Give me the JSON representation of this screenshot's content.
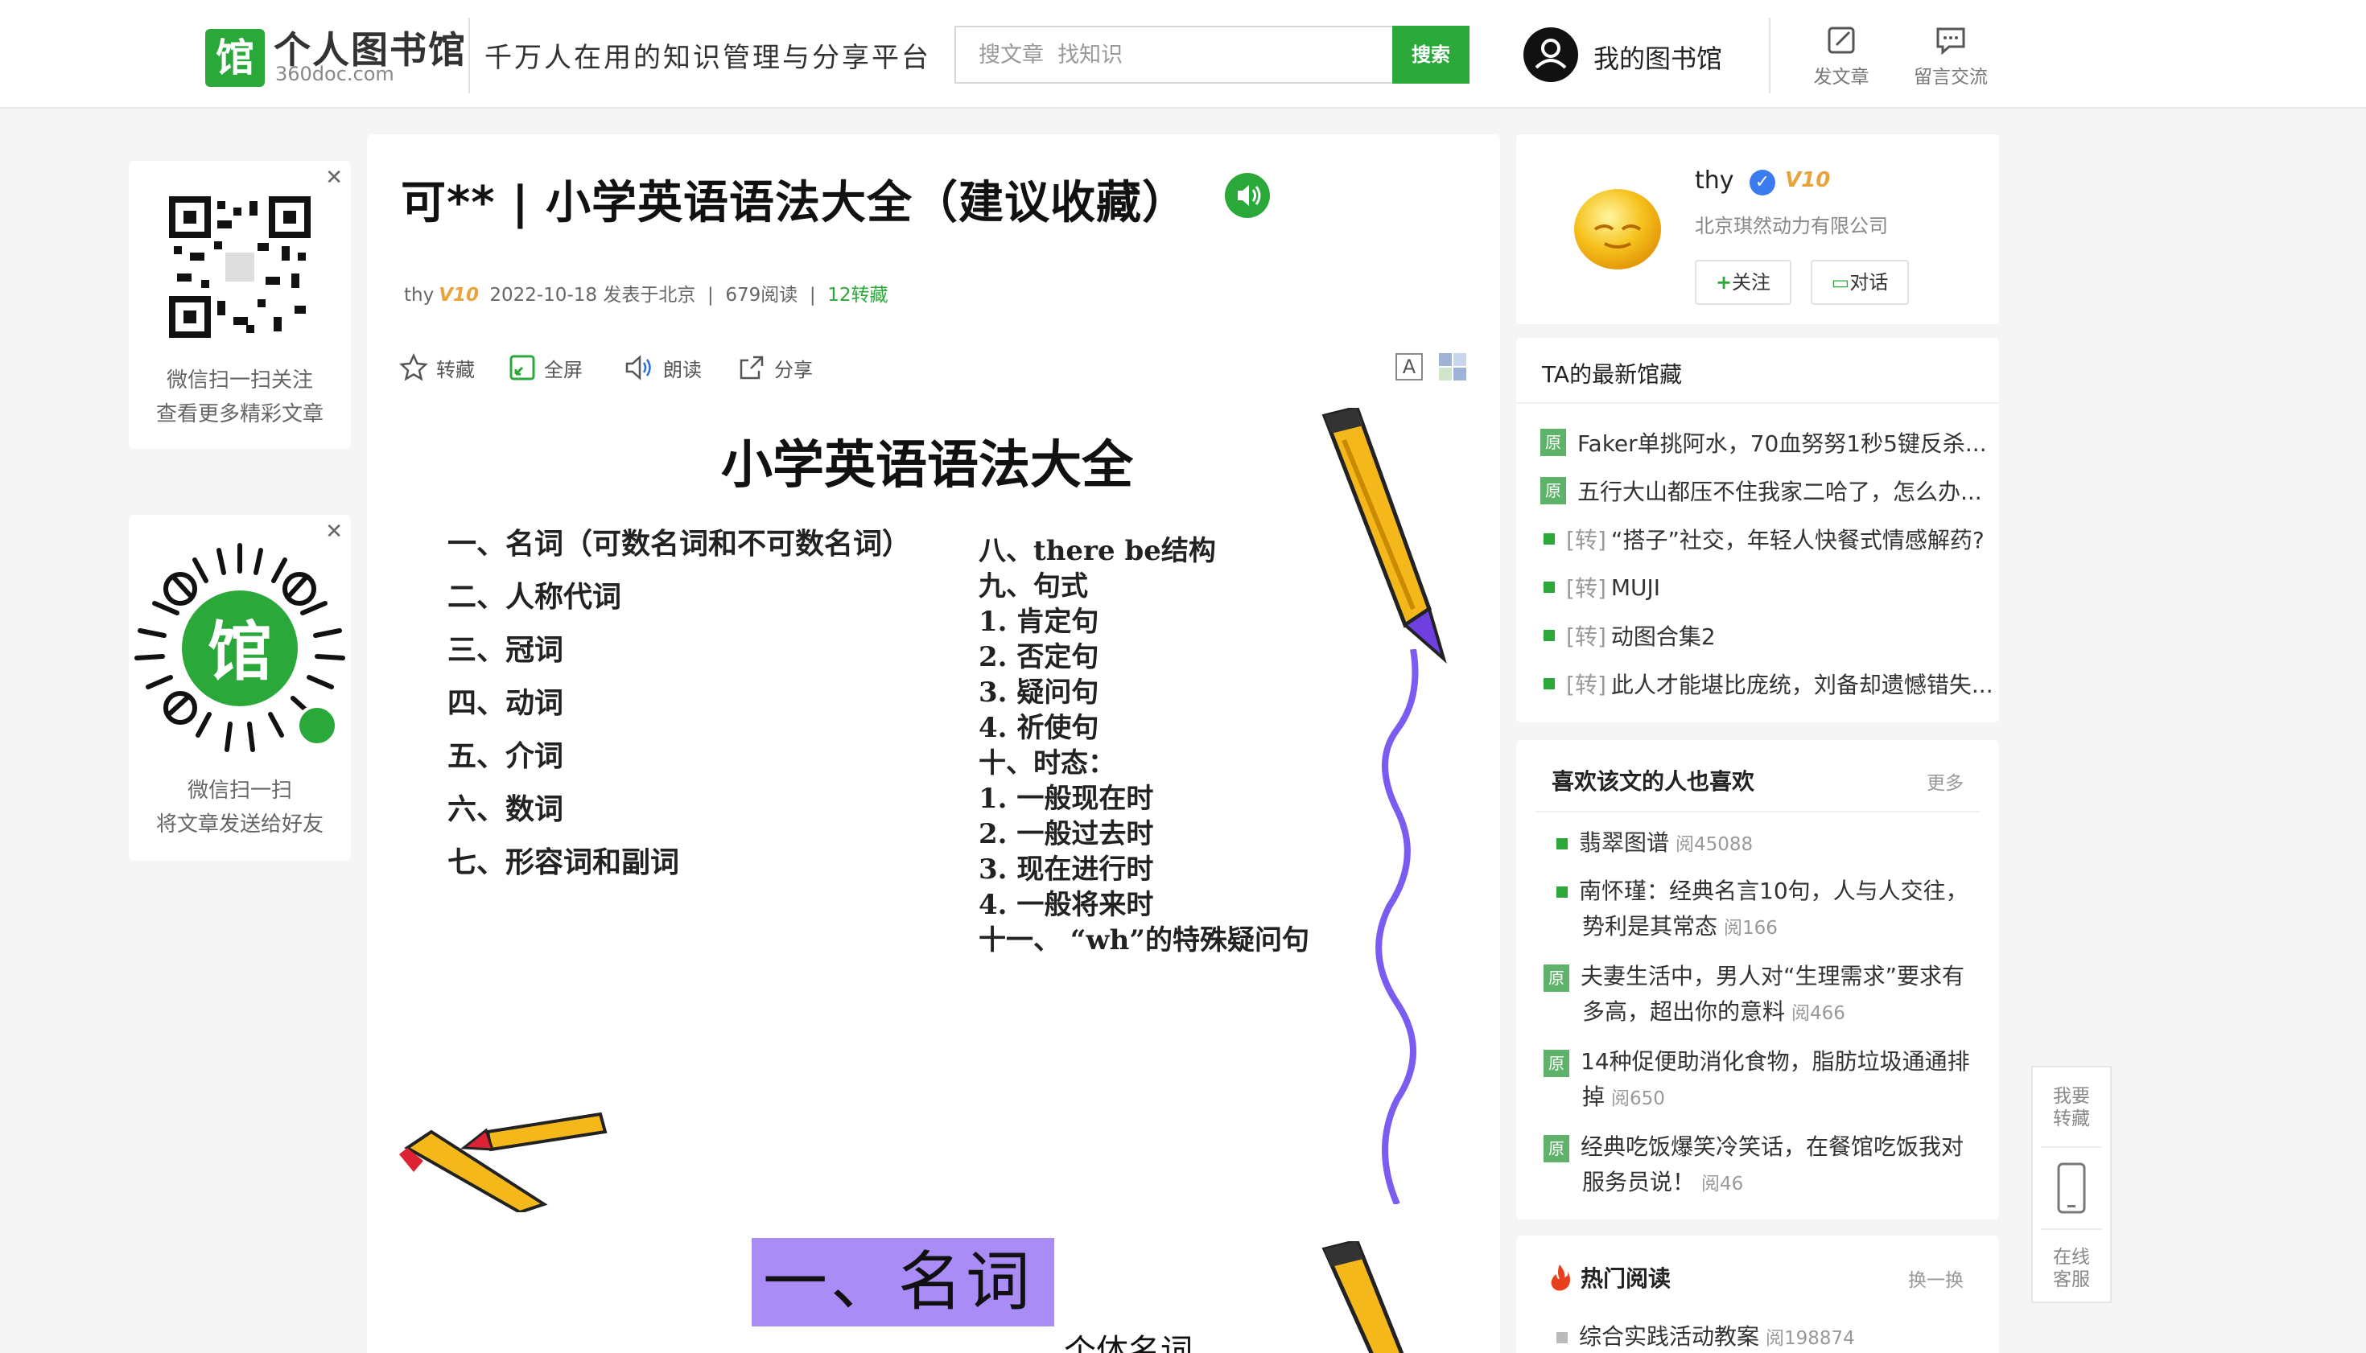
{
  "header": {
    "logo_title": "个人图书馆",
    "logo_domain": "360doc.com",
    "slogan": "千万人在用的知识管理与分享平台",
    "search_placeholder": "搜文章  找知识",
    "search_button": "搜索",
    "my_library": "我的图书馆",
    "post_article": "发文章",
    "message": "留言交流"
  },
  "left_panels": {
    "wechat_follow": [
      "微信扫一扫关注",
      "查看更多精彩文章"
    ],
    "wechat_share": [
      "微信扫一扫",
      "将文章发送给好友"
    ]
  },
  "article": {
    "title": "可** | 小学英语语法大全（建议收藏）",
    "meta": {
      "author": "thy",
      "vip": "V10",
      "date_location": "2022-10-18 发表于北京",
      "reads": "679阅读",
      "shares": "12转藏"
    },
    "toolbar": {
      "save": "转藏",
      "fullscreen": "全屏",
      "read_aloud": "朗读",
      "share": "分享",
      "font": "A"
    },
    "slide1": {
      "title": "小学英语语法大全",
      "left_items": [
        "一、名词（可数名词和不可数名词）",
        "二、人称代词",
        "三、冠词",
        "四、动词",
        "五、介词",
        "六、数词",
        "七、形容词和副词"
      ],
      "right_items": [
        "八、there be结构",
        "九、句式",
        "1. 肯定句",
        "2. 否定句",
        "3. 疑问句",
        "4. 祈使句",
        "十、时态：",
        "1.  一般现在时",
        "2.  一般过去时",
        "3.  现在进行时",
        "4.  一般将来时",
        "十一、 “wh”的特殊疑问句"
      ]
    },
    "slide2": {
      "banner": "一、名词",
      "sub": "个体名词"
    }
  },
  "author_card": {
    "name": "thy",
    "vip": "V10",
    "company": "北京琪然动力有限公司",
    "follow": "关注",
    "chat": "对话"
  },
  "collect_card": {
    "title": "TA的最新馆藏",
    "items": [
      {
        "tag": "原",
        "text": "Faker单挑阿水，70血努努1秒5键反杀..."
      },
      {
        "tag": "原",
        "text": "五行大山都压不住我家二哈了，怎么办..."
      },
      {
        "tag": "转",
        "text": "“搭子”社交，年轻人快餐式情感解药?"
      },
      {
        "tag": "转",
        "text": "MUJI"
      },
      {
        "tag": "转",
        "text": "动图合集2"
      },
      {
        "tag": "转",
        "text": "此人才能堪比庞统，刘备却遗憾错失..."
      }
    ]
  },
  "like_card": {
    "title": "喜欢该文的人也喜欢",
    "more": "更多",
    "items": [
      {
        "tag": "sq",
        "line1": "翡翠图谱",
        "line2": "",
        "reads": "阅45088"
      },
      {
        "tag": "sq",
        "line1": "南怀瑾：经典名言10句，人与人交往，",
        "line2": "势利是其常态",
        "reads": "阅166"
      },
      {
        "tag": "原",
        "line1": "夫妻生活中，男人对“生理需求”要求有",
        "line2": "多高，超出你的意料",
        "reads": "阅466"
      },
      {
        "tag": "原",
        "line1": "14种促便助消化食物，脂肪垃圾通通排",
        "line2": "掉",
        "reads": "阅650"
      },
      {
        "tag": "原",
        "line1": "经典吃饭爆笑冷笑话，在餐馆吃饭我对",
        "line2": "服务员说！",
        "reads": "阅46"
      }
    ]
  },
  "hot_card": {
    "title": "热门阅读",
    "refresh": "换一换",
    "items": [
      {
        "text": "综合实践活动教案",
        "reads": "阅198874"
      }
    ]
  },
  "float_bar": {
    "save": [
      "我要",
      "转藏"
    ],
    "service": [
      "在线",
      "客服"
    ]
  },
  "colors": {
    "brand_green": "#2ba83a",
    "vip_gold": "#e8a33d",
    "banner_purple": "#a98cf5"
  }
}
